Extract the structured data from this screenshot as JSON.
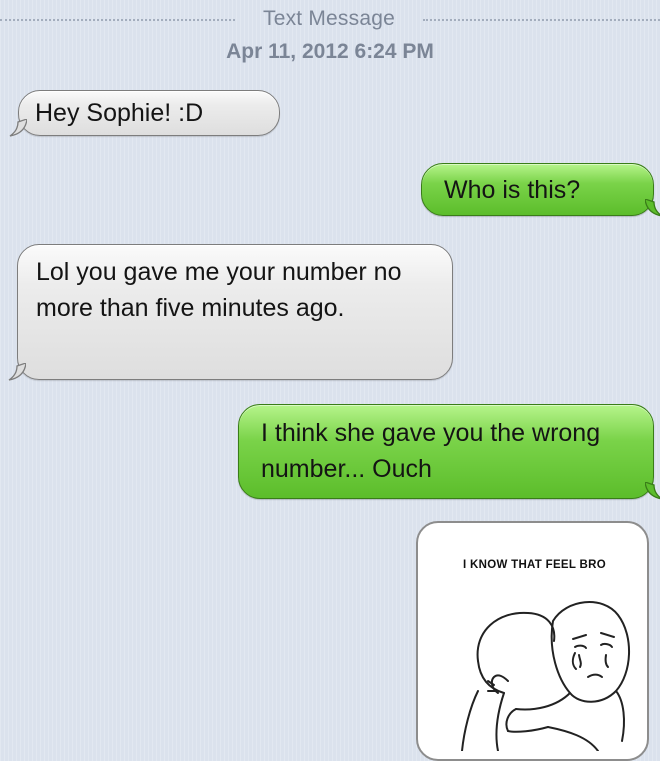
{
  "header": {
    "title": "Text Message",
    "timestamp": "Apr 11, 2012 6:24 PM"
  },
  "messages": [
    {
      "direction": "incoming",
      "text": "Hey Sophie! :D"
    },
    {
      "direction": "outgoing",
      "text": "Who is this?"
    },
    {
      "direction": "incoming",
      "text": "Lol you gave me your number no more than five minutes ago."
    },
    {
      "direction": "outgoing",
      "text": "I think she gave you the wrong number... Ouch"
    }
  ],
  "image_message": {
    "direction": "outgoing",
    "caption": "I KNOW THAT FEEL BRO",
    "image": "hugging-meme-drawing"
  },
  "colors": {
    "background": "#dbe2ed",
    "incoming_bubble": "#e6e6e6",
    "outgoing_bubble": "#6cc93b",
    "header_text": "#7b8596"
  }
}
